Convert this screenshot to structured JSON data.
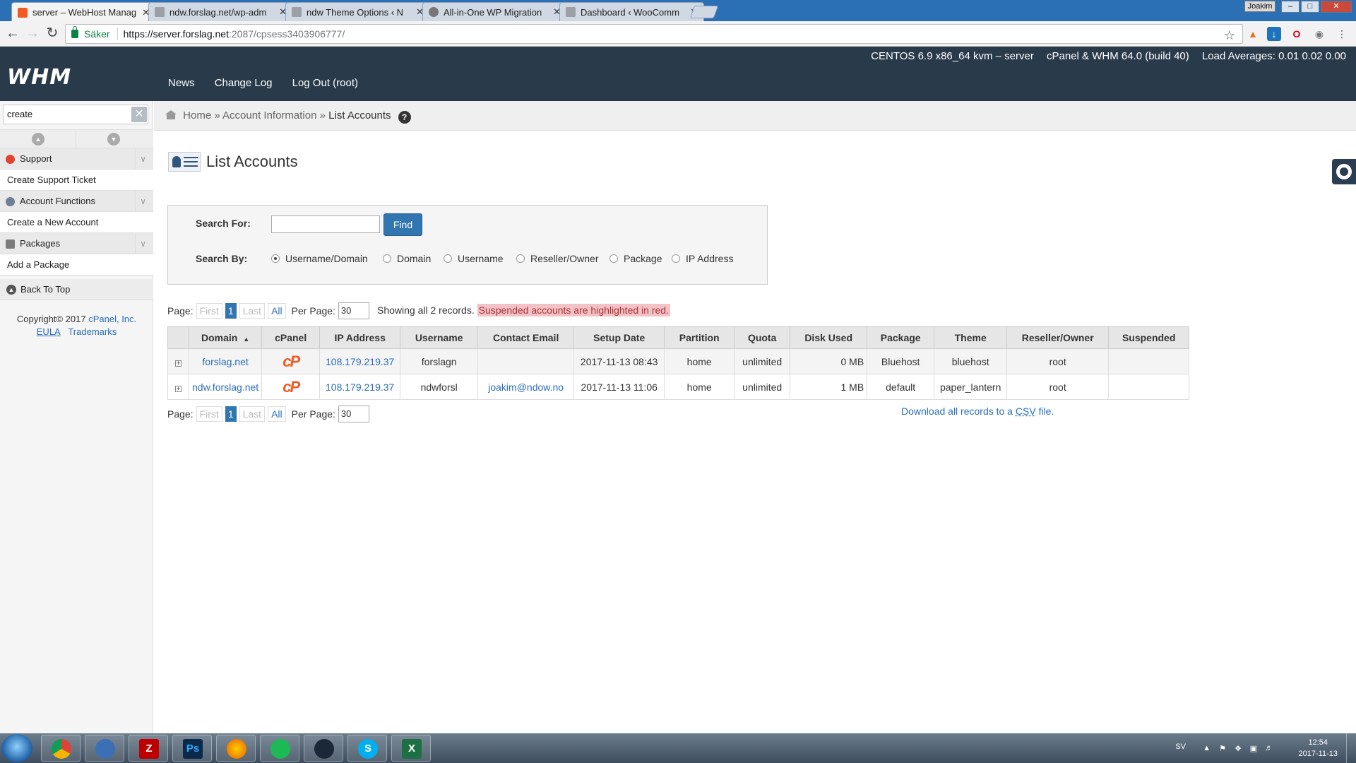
{
  "browser": {
    "tabs": [
      {
        "title": "server – WebHost Manag",
        "icon_color": "#f15a22",
        "active": true
      },
      {
        "title": "ndw.forslag.net/wp-adm",
        "icon_color": "#9aa0a6",
        "active": false
      },
      {
        "title": "ndw Theme Options ‹ N",
        "icon_color": "#9aa0a6",
        "active": false
      },
      {
        "title": "All-in-One WP Migration",
        "icon_color": "#777777",
        "active": false
      },
      {
        "title": "Dashboard ‹ WooComm",
        "icon_color": "#9aa0a6",
        "active": false
      }
    ],
    "tab_close": "✕",
    "profile_name": "Joakim",
    "secure_label": "Säker",
    "url_host": "https://server.forslag.net",
    "url_rest": ":2087/cpsess3403906777/"
  },
  "header": {
    "logo": "WHM",
    "server_info": "CENTOS 6.9 x86_64 kvm – server",
    "version": "cPanel & WHM 64.0 (build 40)",
    "load": "Load Averages: 0.01 0.02 0.00",
    "nav": [
      "News",
      "Change Log",
      "Log Out (root)"
    ]
  },
  "sidebar": {
    "search_value": "create",
    "categories": [
      {
        "label": "Support",
        "item": "Create Support Ticket",
        "icon_color": "#e0452e"
      },
      {
        "label": "Account Functions",
        "item": "Create a New Account",
        "icon_color": "#6f7f95"
      },
      {
        "label": "Packages",
        "item": "Add a Package",
        "icon_color": "#7c7c7c"
      }
    ],
    "back_to_top": "Back To Top",
    "copyright_prefix": "Copyright© 2017",
    "copyright_company": "cPanel, Inc.",
    "eula": "EULA",
    "trademarks": "Trademarks"
  },
  "breadcrumb": {
    "home": "Home",
    "separator": "»",
    "section": "Account Information",
    "current": "List Accounts",
    "help": "?"
  },
  "page": {
    "title": "List Accounts"
  },
  "search": {
    "label_for": "Search For:",
    "input_value": "",
    "find_button": "Find",
    "label_by": "Search By:",
    "options": [
      "Username/Domain",
      "Domain",
      "Username",
      "Reseller/Owner",
      "Package",
      "IP Address"
    ],
    "selected": "Username/Domain"
  },
  "pagination": {
    "page_label": "Page:",
    "first": "First",
    "current": "1",
    "last": "Last",
    "all": "All",
    "per_page_label": "Per Page:",
    "per_page_value": "30"
  },
  "records": {
    "summary": "Showing all 2 records.",
    "suspended_note": "Suspended accounts are highlighted in red."
  },
  "table": {
    "columns": [
      "Domain",
      "cPanel",
      "IP Address",
      "Username",
      "Contact Email",
      "Setup Date",
      "Partition",
      "Quota",
      "Disk Used",
      "Package",
      "Theme",
      "Reseller/Owner",
      "Suspended"
    ],
    "sort_indicator": "▲",
    "rows": [
      {
        "domain": "forslag.net",
        "cpanel": "cP",
        "ip": "108.179.219.37",
        "username": "forslagn",
        "email": "",
        "setup_date": "2017-11-13 08:43",
        "partition": "home",
        "quota": "unlimited",
        "disk_used": "0 MB",
        "package": "Bluehost",
        "theme": "bluehost",
        "owner": "root",
        "suspended": ""
      },
      {
        "domain": "ndw.forslag.net",
        "cpanel": "cP",
        "ip": "108.179.219.37",
        "username": "ndwforsl",
        "email": "joakim@ndow.no",
        "setup_date": "2017-11-13 11:06",
        "partition": "home",
        "quota": "unlimited",
        "disk_used": "1 MB",
        "package": "default",
        "theme": "paper_lantern",
        "owner": "root",
        "suspended": ""
      }
    ]
  },
  "csv": {
    "prefix": "Download all records to a",
    "abbr": "CSV",
    "suffix": "file."
  },
  "taskbar": {
    "apps": [
      {
        "name": "chrome",
        "glyph": "",
        "color": "#db4437"
      },
      {
        "name": "thunderbird",
        "glyph": "",
        "color": "#3b6fb6"
      },
      {
        "name": "filezilla",
        "glyph": "Z",
        "color": "#bf0000"
      },
      {
        "name": "photoshop",
        "glyph": "Ps",
        "color": "#0b2a4a"
      },
      {
        "name": "firefox",
        "glyph": "",
        "color": "#e66000"
      },
      {
        "name": "spotify",
        "glyph": "",
        "color": "#1db954"
      },
      {
        "name": "steam",
        "glyph": "",
        "color": "#1b2838"
      },
      {
        "name": "skype",
        "glyph": "S",
        "color": "#00aff0"
      },
      {
        "name": "excel",
        "glyph": "X",
        "color": "#1d7044"
      }
    ],
    "language": "SV",
    "time": "12:54",
    "date": "2017-11-13"
  }
}
